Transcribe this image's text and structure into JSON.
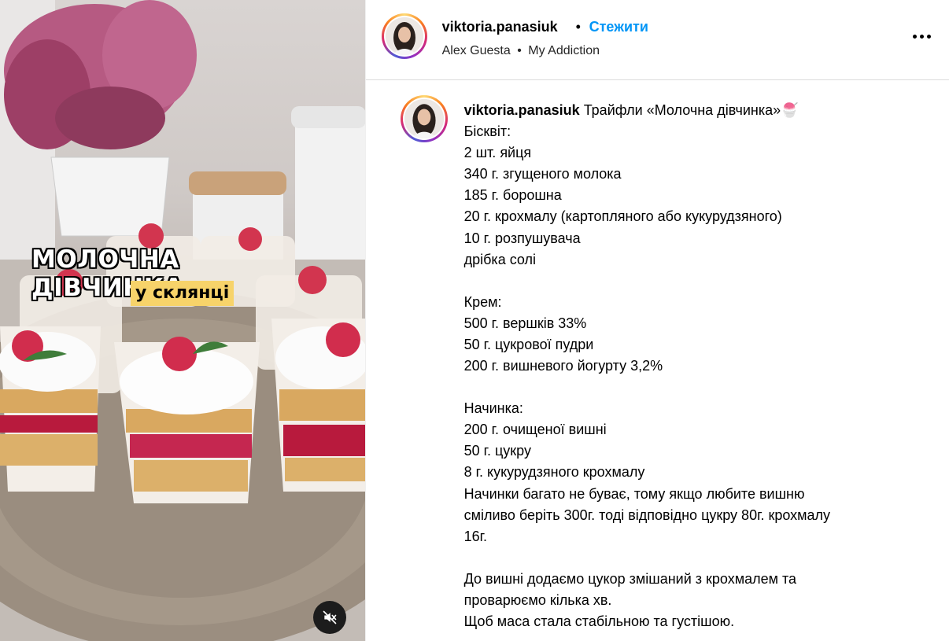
{
  "post": {
    "media": {
      "overlay_title": "МОЛОЧНА ДІВЧИНКА",
      "overlay_subtitle": "у склянці",
      "mute_icon": "speaker-muted-icon"
    },
    "header": {
      "username": "viktoria.panasiuk",
      "separator": "•",
      "follow_label": "Стежити",
      "audio_artist": "Alex Guesta",
      "audio_separator": "•",
      "audio_track": "My Addiction",
      "more_icon": "more-options-icon"
    },
    "caption": {
      "username": "viktoria.panasiuk",
      "title": "Трайфли «Молочна дівчинка»",
      "title_emoji": "🍧",
      "lines": [
        "Бісквіт:",
        "2 шт. яйця",
        "340 г. згущеного молока",
        "185 г. борошна",
        "20 г. крохмалу (картопляного або кукурудзяного)",
        "10 г. розпушувача",
        "дрібка солі",
        "",
        "Крем:",
        "500 г. вершків 33%",
        "50 г. цукрової пудри",
        "200 г. вишневого йогурту 3,2%",
        "",
        "Начинка:",
        "200 г. очищеної вишні",
        "50 г. цукру",
        "8 г. кукурудзяного крохмалу",
        "Начинки багато не буває, тому якщо любите вишню",
        "сміливо беріть 300г. тоді відповідно цукру 80г. крохмалу",
        "16г.",
        "",
        "До вишні додаємо цукор змішаний з крохмалем та",
        "проварюємо кілька хв.",
        "Щоб маса стала стабільною та густішою."
      ]
    }
  },
  "colors": {
    "follow": "#0095f6",
    "overlay_sub_bg": "#f7d36a"
  }
}
